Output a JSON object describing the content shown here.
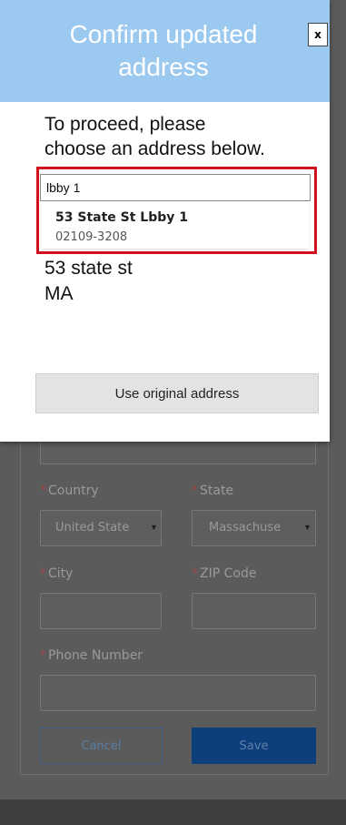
{
  "modal": {
    "title_line1": "Confirm updated",
    "title_line2": "address",
    "close_label": "x",
    "instruction_line1": "To proceed, please",
    "instruction_line2": "choose an address below.",
    "search_value": "lbby 1",
    "suggestion": {
      "line1": "53 State St Lbby 1",
      "line2": "02109-3208"
    },
    "original_address": {
      "line1": "53 state st",
      "line2": "MA"
    },
    "use_original_label": "Use original address",
    "highlight_color": "#d0121f",
    "header_color": "#9cc9ef"
  },
  "form": {
    "country_label": "Country",
    "country_value": "United State",
    "state_label": "State",
    "state_value": "Massachuse",
    "city_label": "City",
    "zip_label": "ZIP Code",
    "phone_label": "Phone Number",
    "required_mark": "*",
    "cancel_label": "Cancel",
    "save_label": "Save"
  }
}
